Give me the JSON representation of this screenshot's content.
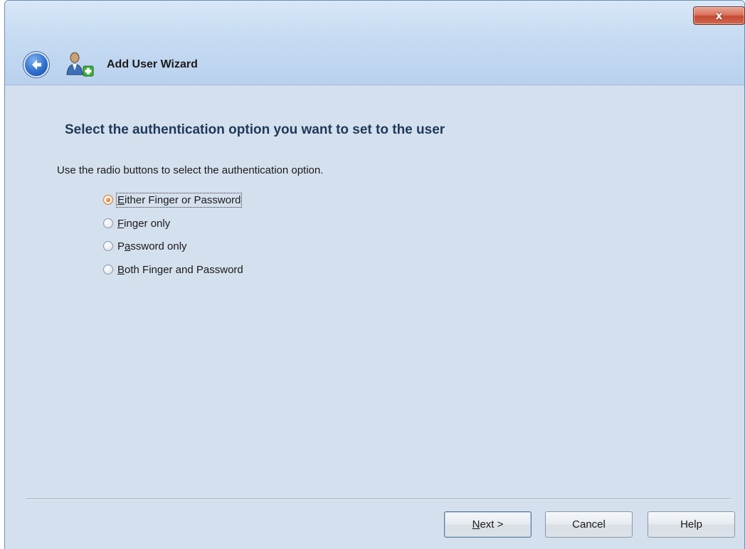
{
  "window": {
    "title": "Add User Wizard",
    "close_label": "x"
  },
  "content": {
    "heading": "Select the authentication option you want to set to the user",
    "instruction": "Use the radio buttons to select the authentication option.",
    "options": [
      {
        "mnemonic": "E",
        "rest": "ither Finger or Password",
        "selected": true
      },
      {
        "mnemonic": "F",
        "rest": "inger only",
        "selected": false
      },
      {
        "pre": "P",
        "mnemonic": "a",
        "rest": "ssword only",
        "selected": false
      },
      {
        "mnemonic": "B",
        "rest": "oth Finger and Password",
        "selected": false
      }
    ]
  },
  "buttons": {
    "next": {
      "mnemonic": "N",
      "rest": "ext >"
    },
    "cancel": "Cancel",
    "help": "Help"
  },
  "icons": {
    "back": "back-arrow-icon",
    "user_add": "add-user-icon",
    "close": "close-icon"
  },
  "colors": {
    "accent_radio": "#f07a1a",
    "heading": "#1e3959",
    "content_bg": "#d5e0ee"
  }
}
